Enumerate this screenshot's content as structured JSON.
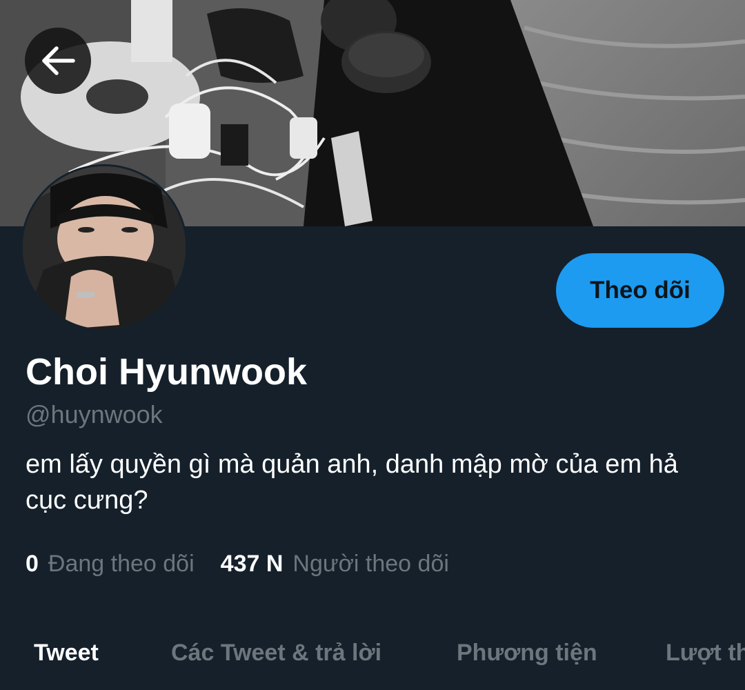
{
  "header": {
    "back_icon": "arrow-left-icon",
    "banner_description": "banner-photo"
  },
  "profile": {
    "display_name": "Choi Hyunwook",
    "handle": "@huynwook",
    "bio": "em lấy quyền gì mà quản anh, danh mập mờ của em hả cục cưng?",
    "follow_label": "Theo dõi",
    "following_count": "0",
    "following_label": "Đang theo dõi",
    "followers_count": "437 N",
    "followers_label": "Người theo dõi"
  },
  "tabs": [
    {
      "label": "Tweet",
      "active": true
    },
    {
      "label": "Các Tweet & trả lời",
      "active": false
    },
    {
      "label": "Phương tiện",
      "active": false
    },
    {
      "label": "Lượt thích",
      "active": false
    }
  ],
  "colors": {
    "background": "#15202b",
    "accent": "#1d9bf0",
    "muted_text": "#6e767d",
    "primary_text": "#ffffff"
  }
}
